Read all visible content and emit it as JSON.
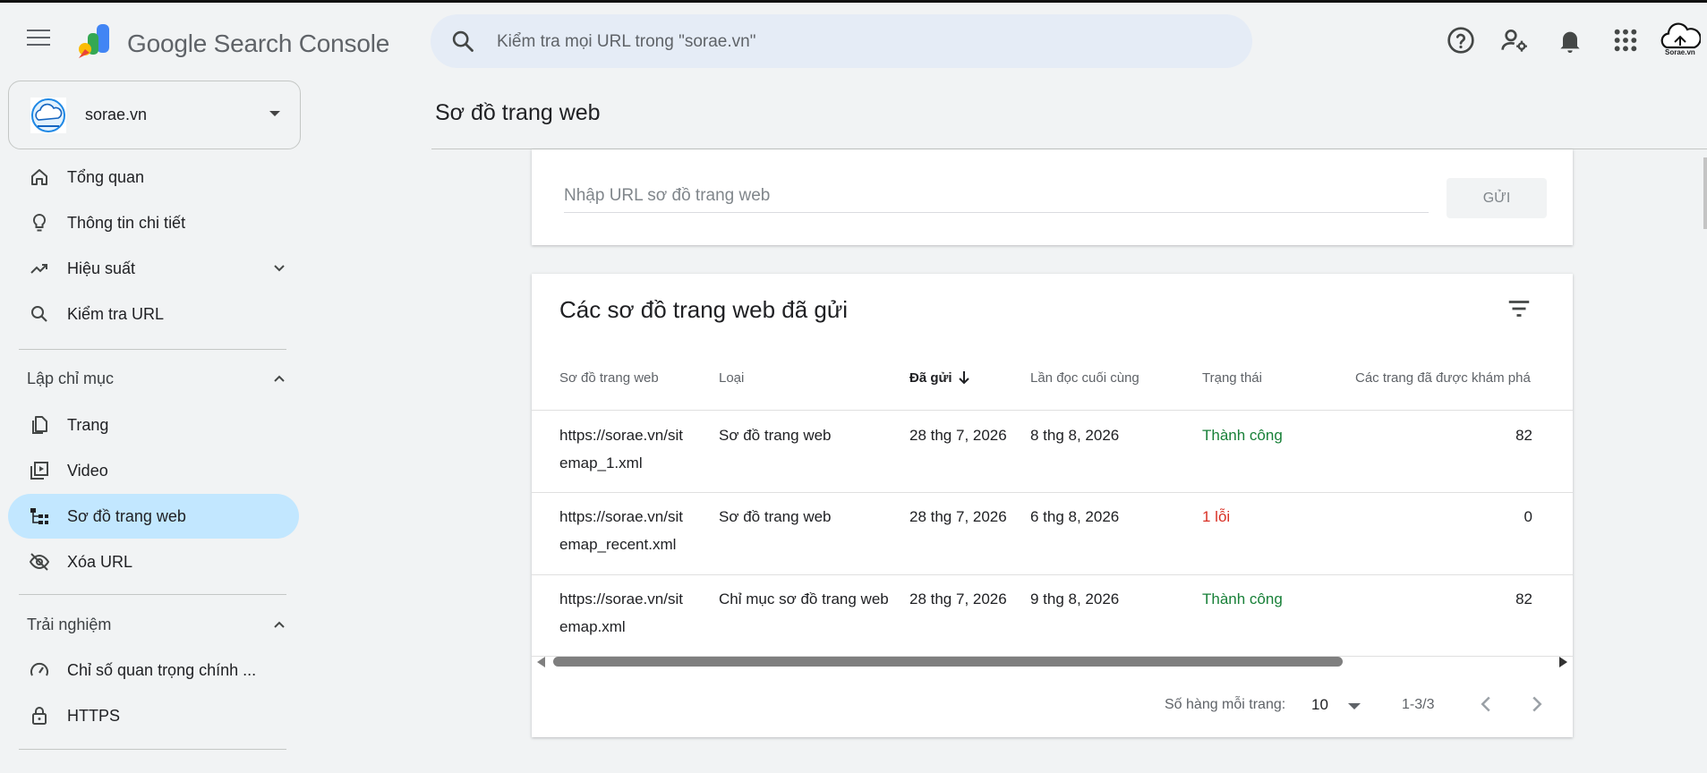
{
  "header": {
    "brand": "Google Search Console",
    "search_placeholder": "Kiểm tra mọi URL trong \"sorae.vn\"",
    "avatar_label": "Sorae.vn"
  },
  "sidebar": {
    "property_name": "sorae.vn",
    "items_top": [
      {
        "label": "Tổng quan",
        "icon": "home-icon"
      },
      {
        "label": "Thông tin chi tiết",
        "icon": "lightbulb-icon"
      },
      {
        "label": "Hiệu suất",
        "icon": "trending-up-icon"
      },
      {
        "label": "Kiểm tra URL",
        "icon": "search-icon"
      }
    ],
    "section_indexing": "Lập chỉ mục",
    "items_indexing": [
      {
        "label": "Trang",
        "icon": "pages-icon"
      },
      {
        "label": "Video",
        "icon": "video-icon"
      },
      {
        "label": "Sơ đồ trang web",
        "icon": "sitemap-icon"
      },
      {
        "label": "Xóa URL",
        "icon": "visibility-off-icon"
      }
    ],
    "section_experience": "Trải nghiệm",
    "items_experience": [
      {
        "label": "Chỉ số quan trọng chính ...",
        "icon": "speed-icon"
      },
      {
        "label": "HTTPS",
        "icon": "lock-icon"
      }
    ]
  },
  "main": {
    "page_title": "Sơ đồ trang web",
    "add_sitemap": {
      "input_placeholder": "Nhập URL sơ đồ trang web",
      "submit_label": "GỬI"
    },
    "submitted": {
      "title": "Các sơ đồ trang web đã gửi",
      "columns": [
        "Sơ đồ trang web",
        "Loại",
        "Đã gửi",
        "Lần đọc cuối cùng",
        "Trạng thái",
        "Các trang đã được khám phá"
      ],
      "rows": [
        {
          "sitemap": "https://sorae.vn/sitemap_1.xml",
          "type": "Sơ đồ trang web",
          "submitted": "28 thg 7, 2026",
          "last_read": "8 thg 8, 2026",
          "status": "Thành công",
          "status_kind": "ok",
          "pages": "82"
        },
        {
          "sitemap": "https://sorae.vn/sitemap_recent.xml",
          "type": "Sơ đồ trang web",
          "submitted": "28 thg 7, 2026",
          "last_read": "6 thg 8, 2026",
          "status": "1 lỗi",
          "status_kind": "err",
          "pages": "0"
        },
        {
          "sitemap": "https://sorae.vn/sitemap.xml",
          "type": "Chỉ mục sơ đồ trang web",
          "submitted": "28 thg 7, 2026",
          "last_read": "9 thg 8, 2026",
          "status": "Thành công",
          "status_kind": "ok",
          "pages": "82"
        }
      ],
      "pager": {
        "rows_label": "Số hàng mỗi trang:",
        "rows_value": "10",
        "range": "1-3/3"
      }
    }
  },
  "colors": {
    "accent": "#c2e7ff",
    "success": "#188038",
    "error": "#d93025",
    "search_bg": "#e5ecf6"
  }
}
